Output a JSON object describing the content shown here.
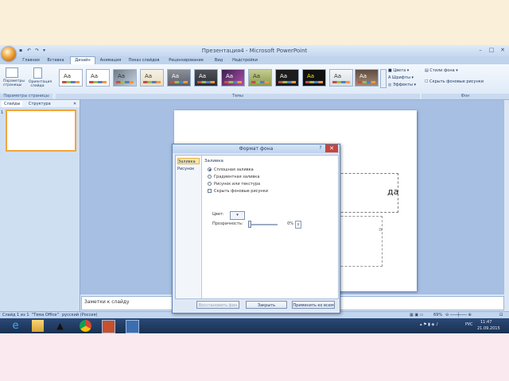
{
  "window": {
    "title": "Презентация4 - Microsoft PowerPoint"
  },
  "qat": {
    "icons": [
      "save-icon",
      "undo-icon",
      "redo-icon",
      "customize-icon"
    ]
  },
  "tabs": [
    "Главная",
    "Вставка",
    "Дизайн",
    "Анимация",
    "Показ слайдов",
    "Рецензирование",
    "Вид",
    "Надстройки"
  ],
  "active_tab": "Дизайн",
  "ribbon": {
    "page_setup": {
      "buttons": [
        "Параметры страницы",
        "Ориентация слайда"
      ],
      "group_label": "Параметры страницы"
    },
    "themes": {
      "tile_text": "Aa",
      "count": 12,
      "group_label": "Темы",
      "side_items": [
        "Цвета",
        "Шрифты",
        "Эффекты"
      ]
    },
    "background": {
      "items": [
        "Стили фона",
        "Скрыть фоновые рисунки"
      ],
      "group_label": "Фон"
    }
  },
  "left_pane": {
    "tabs": [
      "Слайды",
      "Структура"
    ],
    "slide_number": "1"
  },
  "slide": {
    "title_fragment": "да",
    "subtitle_fragment": "а"
  },
  "notes": {
    "text": "Заметки к слайду"
  },
  "status": {
    "slide": "Слайд 1 из 1",
    "theme": "\"Тема Office\"",
    "language": "русский (Россия)",
    "zoom": "69%"
  },
  "tray": {
    "lang": "РУС",
    "time": "11:47",
    "date": "21.09.2015"
  },
  "dialog": {
    "title": "Формат фона",
    "help": "?",
    "close": "✕",
    "nav": [
      "Заливка",
      "Рисунок"
    ],
    "section": "Заливка",
    "options": [
      {
        "label": "Сплошная заливка",
        "type": "radio",
        "checked": true
      },
      {
        "label": "Градиентная заливка",
        "type": "radio",
        "checked": false
      },
      {
        "label": "Рисунок или текстура",
        "type": "radio",
        "checked": false
      },
      {
        "label": "Скрыть фоновые рисунки",
        "type": "checkbox",
        "checked": false
      }
    ],
    "color_label": "Цвет:",
    "color_value": "",
    "transparency_label": "Прозрачность:",
    "transparency_value": "0%",
    "transparency_level": 0,
    "buttons": [
      "Восстановить фон",
      "Закрыть",
      "Применить ко всем"
    ]
  },
  "colors": {
    "top_band": "#faefd9",
    "bottom_band": "#fae9ef",
    "desktop": "#5b7fb1",
    "accent": "#f4a53c"
  }
}
